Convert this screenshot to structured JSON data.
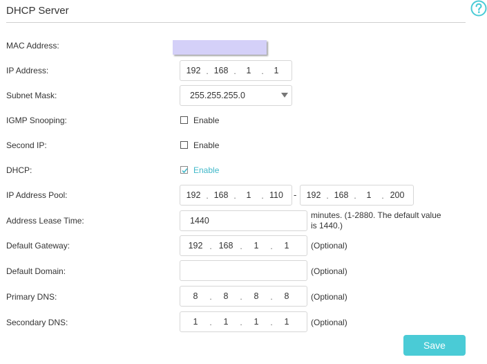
{
  "header": {
    "title": "DHCP Server"
  },
  "fields": {
    "mac_address": {
      "label": "MAC Address:"
    },
    "ip_address": {
      "label": "IP Address:",
      "octets": [
        "192",
        "168",
        "1",
        "1"
      ]
    },
    "subnet_mask": {
      "label": "Subnet Mask:",
      "value": "255.255.255.0"
    },
    "igmp_snooping": {
      "label": "IGMP Snooping:",
      "option": "Enable",
      "checked": false
    },
    "second_ip": {
      "label": "Second IP:",
      "option": "Enable",
      "checked": false
    },
    "dhcp": {
      "label": "DHCP:",
      "option": "Enable",
      "checked": true
    },
    "ip_pool": {
      "label": "IP Address Pool:",
      "start": [
        "192",
        "168",
        "1",
        "110"
      ],
      "separator": "-",
      "end": [
        "192",
        "168",
        "1",
        "200"
      ]
    },
    "lease_time": {
      "label": "Address Lease Time:",
      "value": "1440",
      "hint_line1": "minutes. (1-2880. The default value",
      "hint_line2": "is 1440.)"
    },
    "default_gateway": {
      "label": "Default Gateway:",
      "octets": [
        "192",
        "168",
        "1",
        "1"
      ],
      "hint": "(Optional)"
    },
    "default_domain": {
      "label": "Default Domain:",
      "value": "",
      "hint": "(Optional)"
    },
    "primary_dns": {
      "label": "Primary DNS:",
      "octets": [
        "8",
        "8",
        "8",
        "8"
      ],
      "hint": "(Optional)"
    },
    "secondary_dns": {
      "label": "Secondary DNS:",
      "octets": [
        "1",
        "1",
        "1",
        "1"
      ],
      "hint": "(Optional)"
    }
  },
  "actions": {
    "save_label": "Save"
  },
  "colors": {
    "accent": "#4acbd6",
    "enabled_text": "#3fb8c9",
    "mac_highlight": "#d4d0f8"
  },
  "icons": {
    "help": "question-circle-icon",
    "select_arrow": "caret-down-icon",
    "check": "checkmark-icon"
  }
}
